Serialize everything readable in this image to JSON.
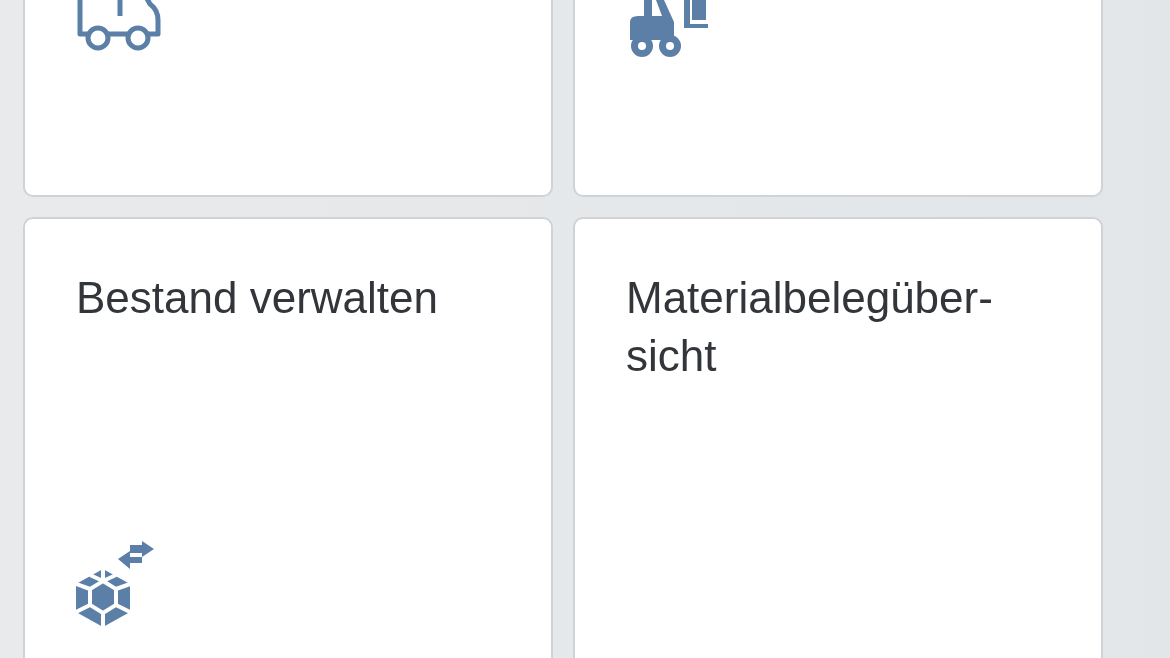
{
  "tiles": [
    {
      "kind": "partial"
    },
    {
      "kind": "partial"
    },
    {
      "kind": "full",
      "title": "Bestand verwalten"
    },
    {
      "kind": "full",
      "title": "Materialbelegüber-\nsicht"
    }
  ]
}
